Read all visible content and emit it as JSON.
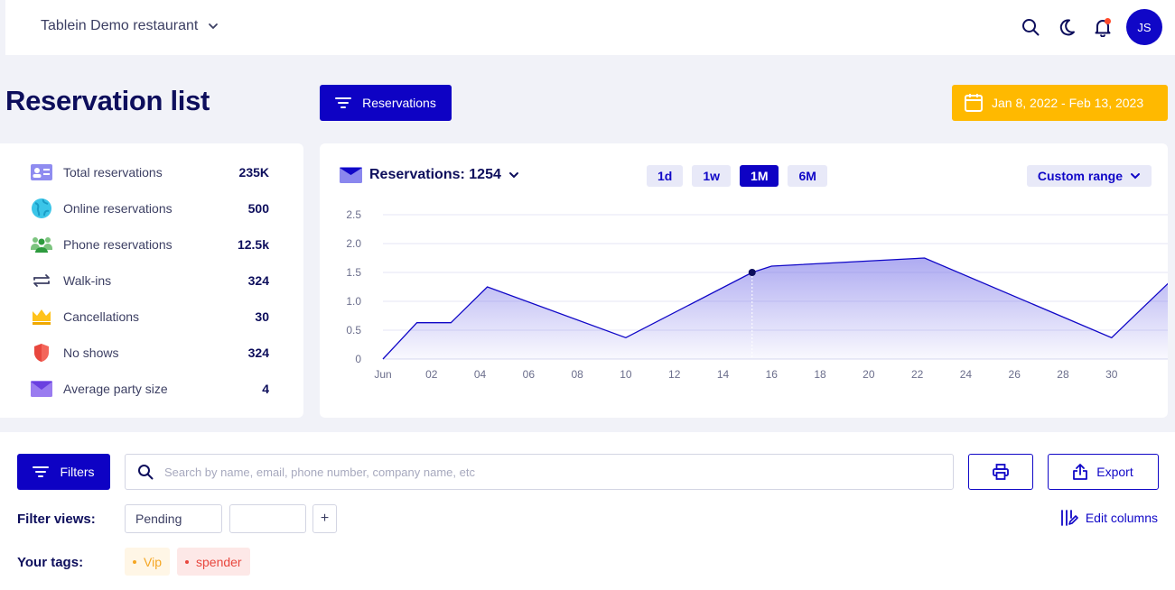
{
  "header": {
    "restaurant": "Tablein Demo restaurant",
    "avatar_initials": "JS",
    "icons": [
      "search-icon",
      "moon-icon",
      "bell-icon"
    ]
  },
  "page": {
    "title": "Reservation list",
    "reservations_button": "Reservations",
    "date_range": "Jan 8, 2022 - Feb 13, 2023"
  },
  "stats": [
    {
      "label": "Total reservations",
      "value": "235K",
      "icon": "id-card-icon"
    },
    {
      "label": "Online reservations",
      "value": "500",
      "icon": "globe-icon"
    },
    {
      "label": "Phone reservations",
      "value": "12.5k",
      "icon": "people-icon"
    },
    {
      "label": "Walk-ins",
      "value": "324",
      "icon": "swap-icon"
    },
    {
      "label": "Cancellations",
      "value": "30",
      "icon": "crown-icon"
    },
    {
      "label": "No shows",
      "value": "324",
      "icon": "shield-icon"
    },
    {
      "label": "Average party size",
      "value": "4",
      "icon": "envelope-icon"
    }
  ],
  "chart_panel": {
    "title": "Reservations: 1254",
    "periods": [
      "1d",
      "1w",
      "1M",
      "6M"
    ],
    "active_period": "1M",
    "custom_range": "Custom range"
  },
  "chart_data": {
    "type": "area",
    "x_ticks": [
      "Jun",
      "02",
      "04",
      "06",
      "08",
      "10",
      "12",
      "14",
      "16",
      "18",
      "20",
      "22",
      "24",
      "26",
      "28",
      "30"
    ],
    "y_ticks": [
      "0",
      "0.5",
      "1.0",
      "1.5",
      "2.0",
      "2.5"
    ],
    "ylim": [
      0,
      2.5
    ],
    "xlim": [
      0,
      32.5
    ],
    "points": [
      [
        0,
        0
      ],
      [
        1.4,
        0.63
      ],
      [
        2.8,
        0.63
      ],
      [
        4.3,
        1.25
      ],
      [
        10,
        0.37
      ],
      [
        15.2,
        1.5
      ],
      [
        16,
        1.61
      ],
      [
        22.3,
        1.75
      ],
      [
        30,
        0.37
      ],
      [
        32.5,
        1.38
      ]
    ],
    "highlight_point": [
      15.2,
      1.5
    ],
    "grid": true,
    "color": "#1007c7"
  },
  "toolbar": {
    "filters": "Filters",
    "search_placeholder": "Search by name, email, phone number, company name, etc",
    "export": "Export",
    "edit_columns": "Edit columns"
  },
  "filter_views": {
    "label": "Filter views:",
    "views": [
      "Pending",
      ""
    ],
    "add": "+"
  },
  "tags": {
    "label": "Your tags:",
    "items": [
      {
        "name": "Vip",
        "color": "#f5a623",
        "bg": "#fff6e6"
      },
      {
        "name": "spender",
        "color": "#e8473e",
        "bg": "#fde8e7"
      }
    ]
  }
}
